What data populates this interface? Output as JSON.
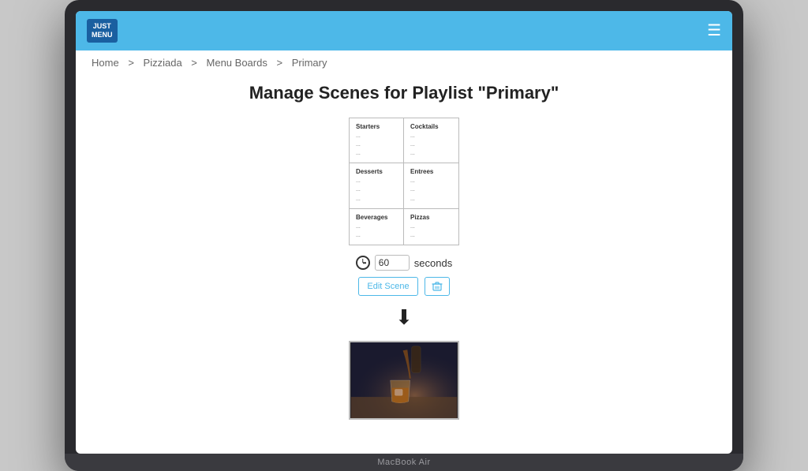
{
  "app": {
    "logo_line1": "JUST",
    "logo_line2": "MENU",
    "title": "MacBook Air"
  },
  "breadcrumb": {
    "items": [
      "Home",
      "Pizziada",
      "Menu Boards",
      "Primary"
    ],
    "separator": ">"
  },
  "page": {
    "title": "Manage Scenes for Playlist \"Primary\""
  },
  "scene1": {
    "cells": [
      {
        "title": "Starters",
        "dots": [
          "...",
          "...",
          "..."
        ]
      },
      {
        "title": "Cocktails",
        "dots": [
          "...",
          "...",
          "..."
        ]
      },
      {
        "title": "Desserts",
        "dots": [
          "...",
          "...",
          "..."
        ]
      },
      {
        "title": "Entrees",
        "dots": [
          "...",
          "...",
          "..."
        ]
      },
      {
        "title": "Beverages",
        "dots": [
          "...",
          "..."
        ]
      },
      {
        "title": "Pizzas",
        "dots": [
          "...",
          "..."
        ]
      }
    ],
    "duration": "60",
    "duration_unit": "seconds",
    "edit_label": "Edit Scene",
    "delete_icon": "🗑"
  },
  "arrow": {
    "symbol": "⬇"
  },
  "scene2": {
    "type": "image",
    "description": "cocktail drink photo"
  }
}
